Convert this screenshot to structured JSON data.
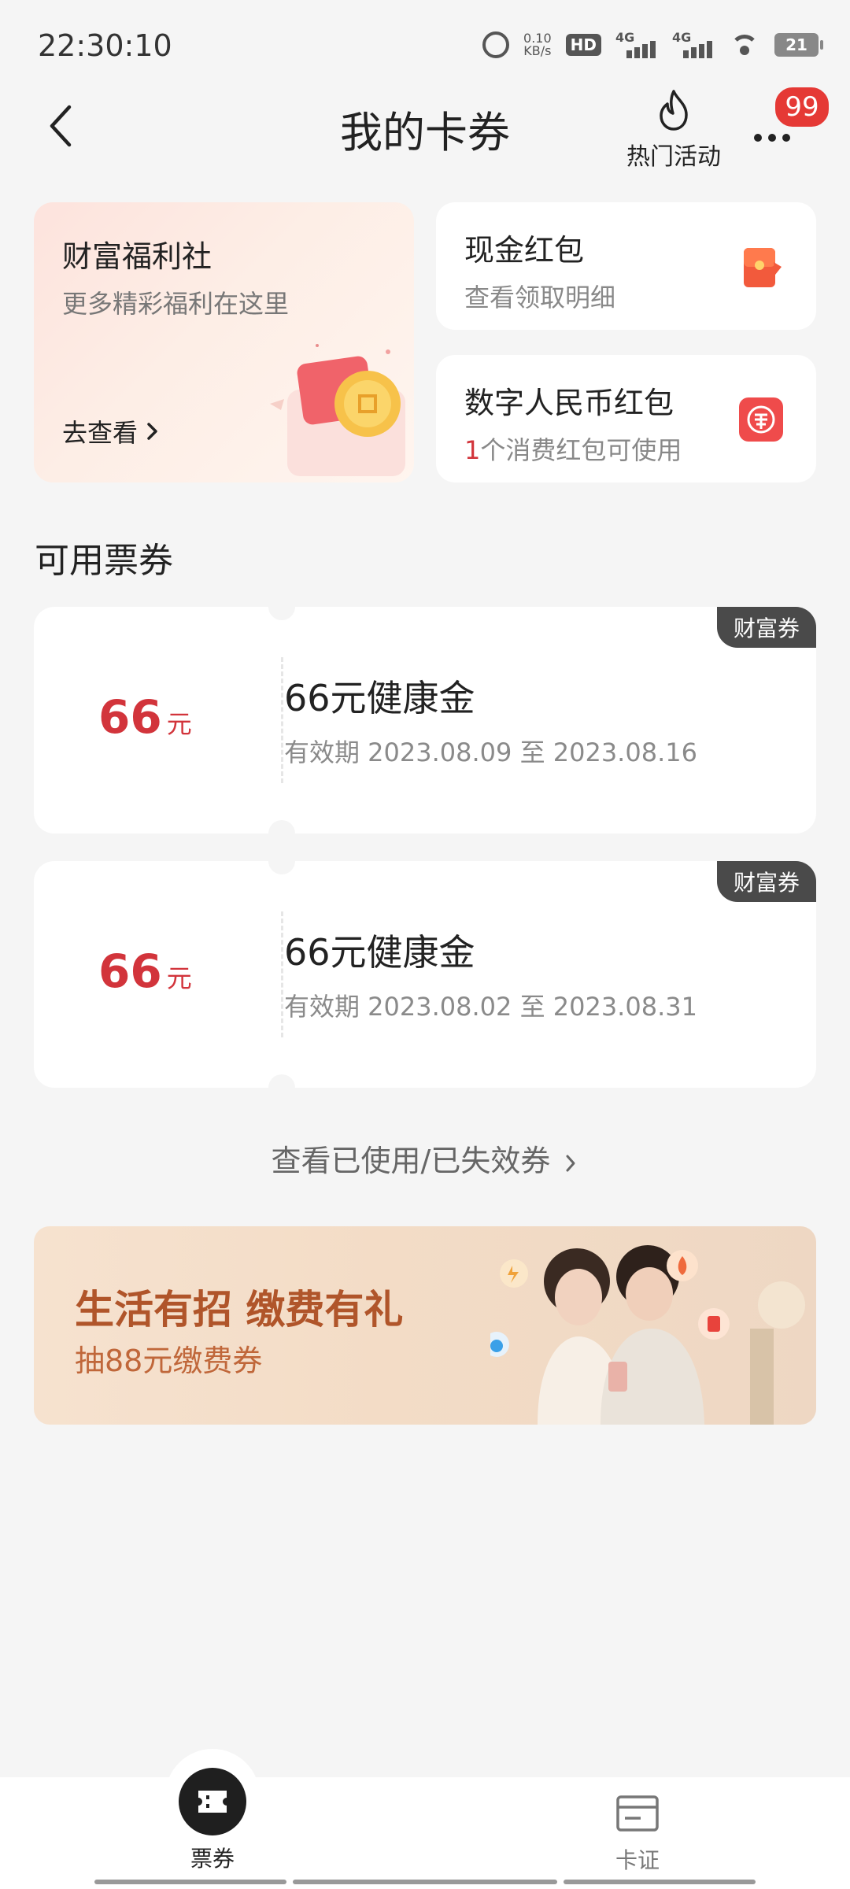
{
  "status_bar": {
    "time": "22:30:10",
    "net_speed_value": "0.10",
    "net_speed_unit": "KB/s",
    "hd_label": "HD",
    "signal1_label": "4G",
    "signal2_label": "4G",
    "battery": "21"
  },
  "header": {
    "title": "我的卡券",
    "hot_label": "热门活动",
    "badge_count": "99"
  },
  "wealth_card": {
    "title": "财富福利社",
    "subtitle": "更多精彩福利在这里",
    "link": "去查看"
  },
  "cash_card": {
    "title": "现金红包",
    "subtitle": "查看领取明细"
  },
  "digital_card": {
    "title": "数字人民币红包",
    "count": "1",
    "subtitle_rest": "个消费红包可使用"
  },
  "section_title": "可用票券",
  "tickets": [
    {
      "amount": "66",
      "unit": "元",
      "name": "66元健康金",
      "validity": "有效期 2023.08.09 至 2023.08.16",
      "tag": "财富券"
    },
    {
      "amount": "66",
      "unit": "元",
      "name": "66元健康金",
      "validity": "有效期 2023.08.02 至 2023.08.31",
      "tag": "财富券"
    }
  ],
  "used_link": "查看已使用/已失效券",
  "banner": {
    "title": "生活有招 缴费有礼",
    "subtitle": "抽88元缴费券"
  },
  "bottom_nav": {
    "tickets_label": "票券",
    "cards_label": "卡证"
  },
  "colors": {
    "accent_red": "#d2343b",
    "badge_red": "#e53935",
    "tag_dark": "#4a4a4a",
    "banner_orange": "#b0552a"
  }
}
